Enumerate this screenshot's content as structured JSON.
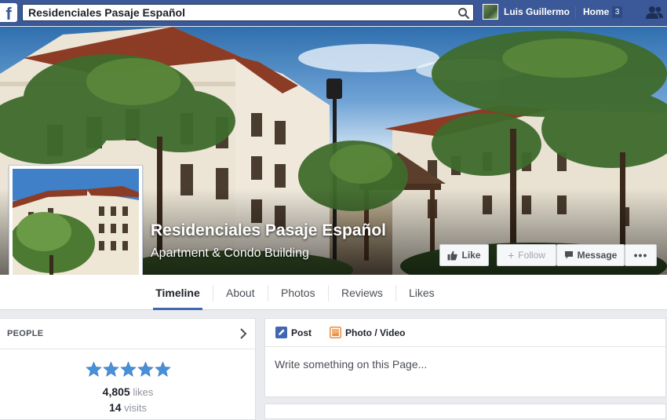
{
  "topbar": {
    "logo": "f",
    "search_value": "Residenciales Pasaje Español",
    "user_name": "Luis Guillermo",
    "home_label": "Home",
    "home_count": "3"
  },
  "page": {
    "name": "Residenciales Pasaje Español",
    "category": "Apartment & Condo Building"
  },
  "actions": {
    "like": "Like",
    "follow": "Follow",
    "message": "Message",
    "more": "•••"
  },
  "tabs": [
    {
      "label": "Timeline",
      "active": true
    },
    {
      "label": "About"
    },
    {
      "label": "Photos"
    },
    {
      "label": "Reviews"
    },
    {
      "label": "Likes"
    }
  ],
  "people": {
    "title": "PEOPLE",
    "rating_stars": 5,
    "likes_count": "4,805",
    "likes_label": "likes",
    "visits_count": "14",
    "visits_label": "visits"
  },
  "composer": {
    "post_label": "Post",
    "photo_label": "Photo / Video",
    "placeholder": "Write something on this Page..."
  },
  "colors": {
    "brand": "#3b5998",
    "star": "#4a90d9",
    "active_tab": "#4267b2"
  }
}
